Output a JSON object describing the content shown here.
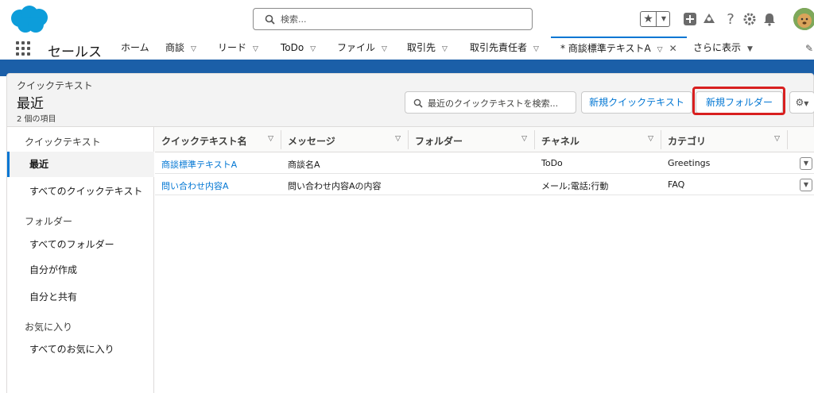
{
  "header": {
    "search_placeholder": "検索...",
    "help_label": "?"
  },
  "nav": {
    "app_name": "セールス",
    "items": [
      {
        "label": "ホーム"
      },
      {
        "label": "商談"
      },
      {
        "label": "リード"
      },
      {
        "label": "ToDo"
      },
      {
        "label": "ファイル"
      },
      {
        "label": "取引先"
      },
      {
        "label": "取引先責任者"
      }
    ],
    "active_tab": "* 商談標準テキストA",
    "more_label": "さらに表示"
  },
  "page": {
    "object_type": "クイックテキスト",
    "title": "最近",
    "item_count": "2 個の項目",
    "search_placeholder": "最近のクイックテキストを検索...",
    "new_quick_text_label": "新規クイックテキスト",
    "new_folder_label": "新規フォルダー"
  },
  "sidebar": {
    "section_quick_text": "クイックテキスト",
    "item_recent": "最近",
    "item_all_quick_text": "すべてのクイックテキスト",
    "section_folders": "フォルダー",
    "item_all_folders": "すべてのフォルダー",
    "item_created_by_me": "自分が作成",
    "item_shared_with_me": "自分と共有",
    "section_favorites": "お気に入り",
    "item_all_favorites": "すべてのお気に入り"
  },
  "table": {
    "columns": [
      "クイックテキスト名",
      "メッセージ",
      "フォルダー",
      "チャネル",
      "カテゴリ"
    ],
    "rows": [
      {
        "name": "商談標準テキストA",
        "message": "商談名A",
        "folder": "",
        "channel": "ToDo",
        "category": "Greetings"
      },
      {
        "name": "問い合わせ内容A",
        "message": "問い合わせ内容Aの内容",
        "folder": "",
        "channel": "メール;電話;行動",
        "category": "FAQ"
      }
    ]
  },
  "colors": {
    "brand_blue": "#1b5fa8",
    "link_blue": "#0176d3",
    "highlight_red": "#d81f1f"
  }
}
